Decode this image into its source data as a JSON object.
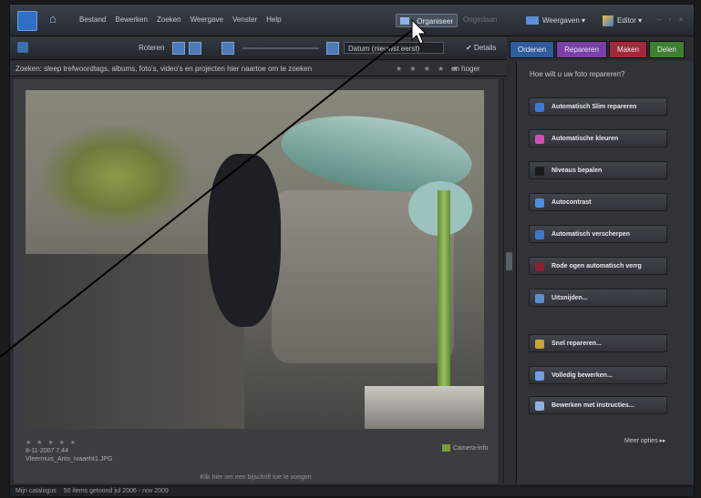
{
  "menubar": {
    "items": [
      "Bestand",
      "Bewerken",
      "Zoeken",
      "Weergave",
      "Venster",
      "Help"
    ],
    "organiseer": "Organiseer",
    "undo": "Ongedaan",
    "weergaven": "Weergaven",
    "editor": "Editor",
    "window_controls": "– ▫ ×"
  },
  "toolbar": {
    "roteren": "Roteren",
    "sort": "Datum (nieuwst eerst)",
    "details": "Details"
  },
  "tabs": [
    {
      "label": "Ordenen",
      "color": "#2f5c9c"
    },
    {
      "label": "Repareren",
      "color": "#7a3fa8"
    },
    {
      "label": "Maken",
      "color": "#a5283a"
    },
    {
      "label": "Delen",
      "color": "#3f7f2f"
    }
  ],
  "search": {
    "text": "Zoeken: sleep trefwoordtags, albums, foto's, video's en projecten hier naartoe om te zoeken",
    "stars": "★ ★ ★ ★ ★",
    "hoger": "en hoger"
  },
  "photo": {
    "stars": "★ ★ ★ ★ ★",
    "date": "8-11-2007 7:44",
    "filename": "Vleermuis_Artis_Ivaaeht1.JPG",
    "camera_label": "Camera-info",
    "caption": "Klik hier om een bijschrift toe te voegen"
  },
  "panel": {
    "heading": "Hoe wilt u uw foto repareren?",
    "buttons": [
      {
        "label": "Automatisch Slim repareren",
        "icon": "auto-smart-fix-icon",
        "color": "#3a7bd5"
      },
      {
        "label": "Automatische kleuren",
        "icon": "auto-color-icon",
        "color": "#d04fb0"
      },
      {
        "label": "Niveaus bepalen",
        "icon": "levels-icon",
        "color": "#1a1a1a"
      },
      {
        "label": "Autocontrast",
        "icon": "auto-contrast-icon",
        "color": "#4a8fe0"
      },
      {
        "label": "Automatisch verscherpen",
        "icon": "auto-sharpen-icon",
        "color": "#3e78c8"
      },
      {
        "label": "Rode ogen automatisch verrg",
        "icon": "red-eye-icon",
        "color": "#8a2030"
      },
      {
        "label": "Uitsnijden...",
        "icon": "crop-icon",
        "color": "#5b8ed0"
      },
      {
        "label": "Snel repareren...",
        "icon": "quick-fix-icon",
        "color": "#c9a43a"
      },
      {
        "label": "Volledig bewerken...",
        "icon": "full-edit-icon",
        "color": "#6fa0e0"
      },
      {
        "label": "Bewerken met instructies...",
        "icon": "guided-edit-icon",
        "color": "#8fb0e0"
      }
    ],
    "meer": "Meer opties ▸▸"
  },
  "status": {
    "catalog": "Mijn catalogus",
    "items": "50 items getoond   jul 2006 - nov 2009"
  }
}
